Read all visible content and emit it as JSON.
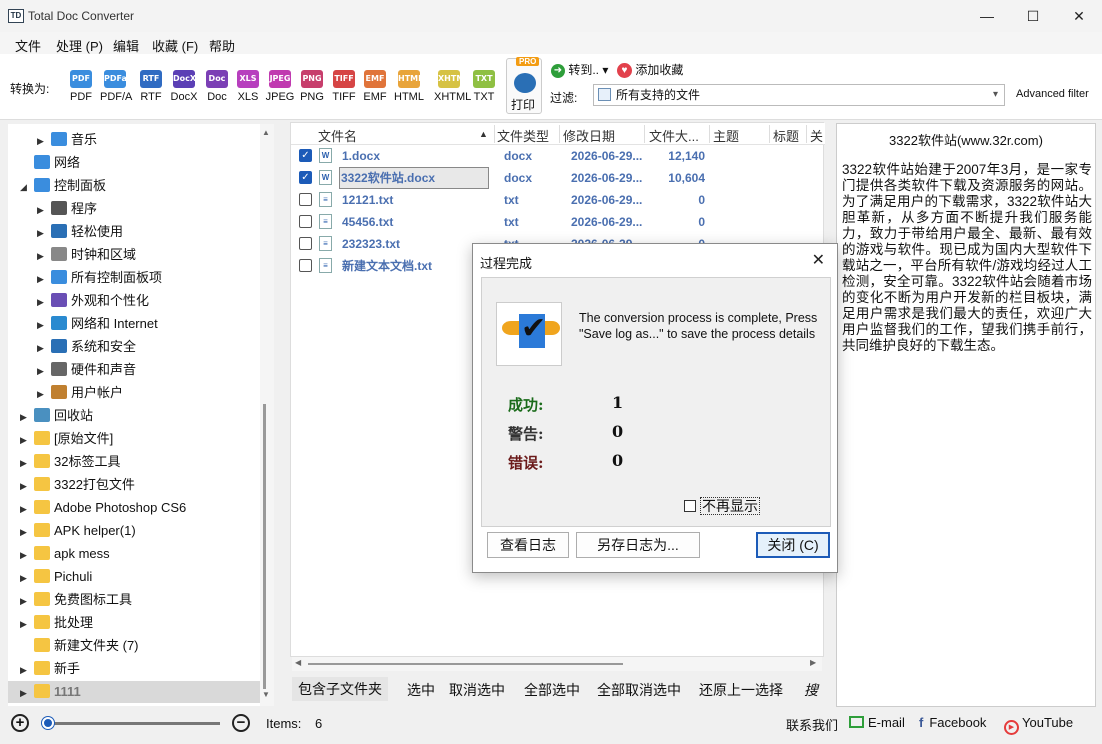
{
  "window": {
    "title": "Total Doc Converter",
    "minimize": "—",
    "maximize": "☐",
    "close": "✕"
  },
  "menu": [
    "文件",
    "处理 (P)",
    "编辑",
    "收藏 (F)",
    "帮助"
  ],
  "toolbar": {
    "convert_label": "转换为:",
    "formats": [
      {
        "icon": "PDF",
        "label": "PDF",
        "color": "#3a8dde"
      },
      {
        "icon": "PDFa",
        "label": "PDF/A",
        "color": "#3a8dde"
      },
      {
        "icon": "RTF",
        "label": "RTF",
        "color": "#2f6bc2"
      },
      {
        "icon": "DocX",
        "label": "DocX",
        "color": "#5b3fb5"
      },
      {
        "icon": "Doc",
        "label": "Doc",
        "color": "#7b3fb5"
      },
      {
        "icon": "XLS",
        "label": "XLS",
        "color": "#b73fbe"
      },
      {
        "icon": "JPEG",
        "label": "JPEG",
        "color": "#c03ab0"
      },
      {
        "icon": "PNG",
        "label": "PNG",
        "color": "#c73e6c"
      },
      {
        "icon": "TIFF",
        "label": "TIFF",
        "color": "#d64545"
      },
      {
        "icon": "EMF",
        "label": "EMF",
        "color": "#e0743a"
      },
      {
        "icon": "HTML",
        "label": "HTML",
        "color": "#e8a43a"
      },
      {
        "icon": "XHTML",
        "label": "XHTML",
        "color": "#d6c244"
      },
      {
        "icon": "TXT",
        "label": "TXT",
        "color": "#8fc043"
      }
    ],
    "pro_badge": "PRO",
    "print_label": "打印",
    "goto_label": "转到..",
    "goto_arrow": "▾",
    "favorite_label": "添加收藏",
    "filter_label": "过滤:",
    "filter_value": "所有支持的文件",
    "advanced_filter": "Advanced filter"
  },
  "tree": [
    {
      "label": "音乐",
      "indent": 1,
      "arrow": "▶",
      "icon_color": "#3a8dde"
    },
    {
      "label": "网络",
      "indent": 0,
      "arrow": "",
      "icon_color": "#3a8dde"
    },
    {
      "label": "控制面板",
      "indent": 0,
      "arrow": "◢",
      "icon_color": "#3a8dde"
    },
    {
      "label": "程序",
      "indent": 1,
      "arrow": "▶",
      "icon_color": "#555"
    },
    {
      "label": "轻松使用",
      "indent": 1,
      "arrow": "▶",
      "icon_color": "#2a6fb5"
    },
    {
      "label": "时钟和区域",
      "indent": 1,
      "arrow": "▶",
      "icon_color": "#888"
    },
    {
      "label": "所有控制面板项",
      "indent": 1,
      "arrow": "▶",
      "icon_color": "#3a8dde"
    },
    {
      "label": "外观和个性化",
      "indent": 1,
      "arrow": "▶",
      "icon_color": "#6a4fb5"
    },
    {
      "label": "网络和 Internet",
      "indent": 1,
      "arrow": "▶",
      "icon_color": "#2a8ad0"
    },
    {
      "label": "系统和安全",
      "indent": 1,
      "arrow": "▶",
      "icon_color": "#2a6fb5"
    },
    {
      "label": "硬件和声音",
      "indent": 1,
      "arrow": "▶",
      "icon_color": "#666"
    },
    {
      "label": "用户帐户",
      "indent": 1,
      "arrow": "▶",
      "icon_color": "#c08030"
    },
    {
      "label": "回收站",
      "indent": 0,
      "arrow": "▶",
      "icon_color": "#4a90c0"
    },
    {
      "label": "[原始文件]",
      "indent": 0,
      "arrow": "▶",
      "icon_color": "#f5c542"
    },
    {
      "label": "32标签工具",
      "indent": 0,
      "arrow": "▶",
      "icon_color": "#f5c542"
    },
    {
      "label": "3322打包文件",
      "indent": 0,
      "arrow": "▶",
      "icon_color": "#f5c542"
    },
    {
      "label": "Adobe Photoshop CS6",
      "indent": 0,
      "arrow": "▶",
      "icon_color": "#f5c542"
    },
    {
      "label": "APK helper(1)",
      "indent": 0,
      "arrow": "▶",
      "icon_color": "#f5c542"
    },
    {
      "label": "apk mess",
      "indent": 0,
      "arrow": "▶",
      "icon_color": "#f5c542"
    },
    {
      "label": "Pichuli",
      "indent": 0,
      "arrow": "▶",
      "icon_color": "#f5c542"
    },
    {
      "label": "免费图标工具",
      "indent": 0,
      "arrow": "▶",
      "icon_color": "#f5c542"
    },
    {
      "label": "批处理",
      "indent": 0,
      "arrow": "▶",
      "icon_color": "#f5c542"
    },
    {
      "label": "新建文件夹 (7)",
      "indent": 0,
      "arrow": "",
      "icon_color": "#f5c542"
    },
    {
      "label": "新手",
      "indent": 0,
      "arrow": "▶",
      "icon_color": "#f5c542"
    },
    {
      "label": "1111",
      "indent": 0,
      "arrow": "▶",
      "icon_color": "#f5c542",
      "selected": true
    }
  ],
  "filelist": {
    "columns": [
      "文件名",
      "文件类型",
      "修改日期",
      "文件大...",
      "主题",
      "标题",
      "关"
    ],
    "sort_arrow": "▲",
    "rows": [
      {
        "name": "1.docx",
        "type": "docx",
        "date": "2026-06-29...",
        "size": "12,140",
        "checked": true,
        "icon": "W"
      },
      {
        "name": "3322软件站.docx",
        "type": "docx",
        "date": "2026-06-29...",
        "size": "10,604",
        "checked": true,
        "icon": "W",
        "selected": true
      },
      {
        "name": "12121.txt",
        "type": "txt",
        "date": "2026-06-29...",
        "size": "0",
        "checked": false,
        "icon": "≡"
      },
      {
        "name": "45456.txt",
        "type": "txt",
        "date": "2026-06-29...",
        "size": "0",
        "checked": false,
        "icon": "≡"
      },
      {
        "name": "232323.txt",
        "type": "txt",
        "date": "2026-06-29...",
        "size": "0",
        "checked": false,
        "icon": "≡"
      },
      {
        "name": "新建文本文档.txt",
        "type": "",
        "date": "",
        "size": "",
        "checked": false,
        "icon": "≡"
      }
    ]
  },
  "actions": [
    "包含子文件夹",
    "选中",
    "取消选中",
    "全部选中",
    "全部取消选中",
    "还原上一选择",
    "搜"
  ],
  "preview": {
    "title": "3322软件站(www.32r.com)",
    "text": "3322软件站始建于2007年3月，是一家专门提供各类软件下载及资源服务的网站。为了满足用户的下载需求，3322软件站大胆革新，从多方面不断提升我们服务能力，致力于带给用户最全、最新、最有效的游戏与软件。现已成为国内大型软件下载站之一，平台所有软件/游戏均经过人工检测，安全可靠。3322软件站会随着市场的变化不断为用户开发新的栏目板块，满足用户需求是我们最大的责任，欢迎广大用户监督我们的工作，望我们携手前行，共同维护良好的下载生态。"
  },
  "statusbar": {
    "zoom_in": "+",
    "zoom_out": "−",
    "zoom_level": 0,
    "items_label": "Items:",
    "items_count": "6",
    "contact": "联系我们",
    "email": "E-mail",
    "facebook": "Facebook",
    "youtube": "YouTube"
  },
  "dialog": {
    "title": "过程完成",
    "close": "✕",
    "message": "The conversion process is complete, Press \"Save log as...\" to save the process details",
    "success_label": "成功:",
    "success_value": "1",
    "success_color": "#1a6b1a",
    "warning_label": "警告:",
    "warning_value": "0",
    "warning_color": "#333",
    "error_label": "错误:",
    "error_value": "0",
    "error_color": "#6b1a1a",
    "dont_show": "不再显示",
    "view_log": "查看日志",
    "save_log": "另存日志为...",
    "close_button": "关闭 (C)"
  }
}
